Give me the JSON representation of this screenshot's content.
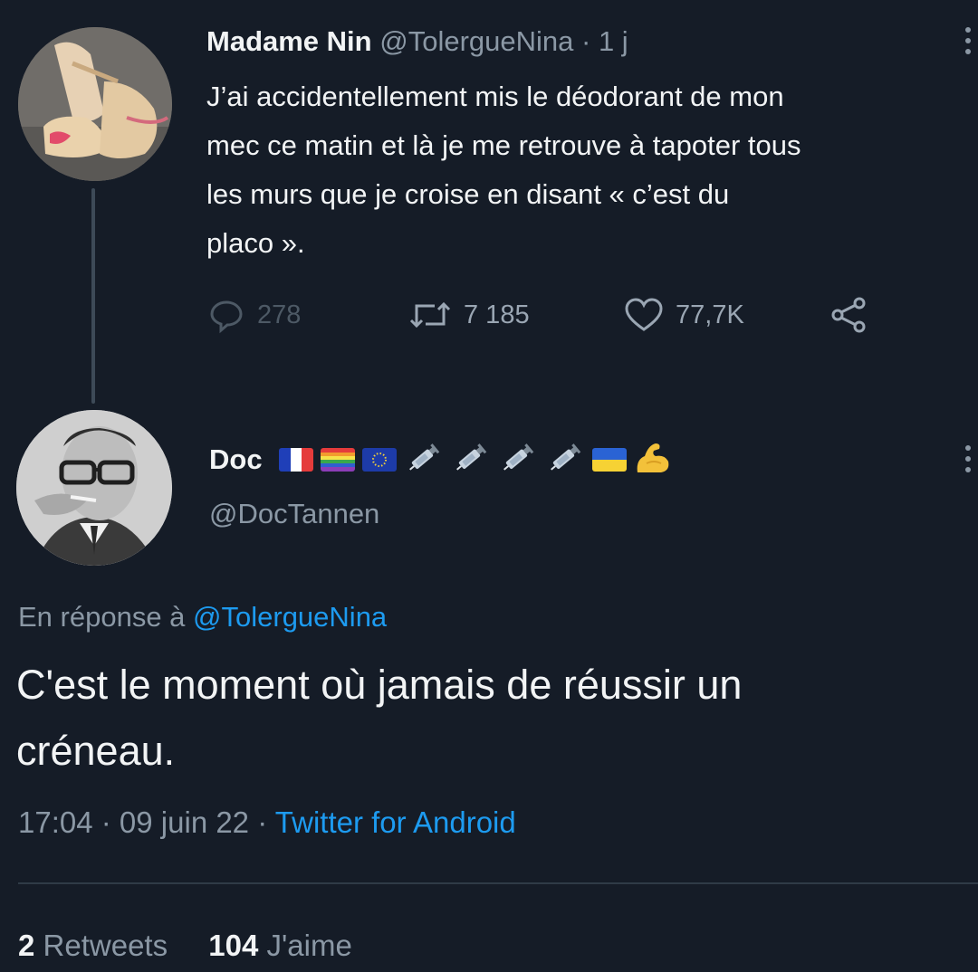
{
  "parent_tweet": {
    "author_name": "Madame Nin",
    "author_handle": "@TolergueNina",
    "separator": " · ",
    "time": "1 j",
    "text": "J’ai accidentellement mis le déodorant de mon\nmec ce matin et là je me retrouve à tapoter tous\nles murs que je croise en disant « c’est du\nplaco ».",
    "replies": "278",
    "retweets": "7 185",
    "likes": "77,7K"
  },
  "reply_tweet": {
    "author_name": "Doc",
    "author_handle": "@DocTannen",
    "name_emojis": [
      "france-flag",
      "rainbow-flag",
      "eu-flag",
      "syringe",
      "syringe",
      "syringe",
      "syringe",
      "ukraine-flag",
      "flexed-biceps"
    ],
    "in_reply_to_prefix": "En réponse à ",
    "in_reply_to_handle": "@TolergueNina",
    "text": "C'est le moment où jamais de réussir un\ncréneau.",
    "time": "17:04",
    "date": "09 juin 22",
    "meta_separator": " · ",
    "source": "Twitter for Android",
    "retweet_count": "2",
    "retweet_label": "Retweets",
    "like_count": "104",
    "like_label": "J'aime"
  },
  "colors": {
    "background": "#151c27",
    "link": "#1d9bf0",
    "secondary_text": "#8b98a5"
  }
}
